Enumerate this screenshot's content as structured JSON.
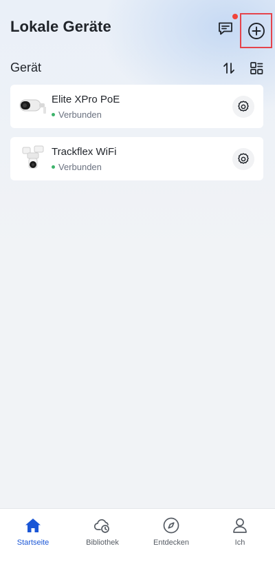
{
  "header": {
    "title": "Lokale Geräte",
    "message_icon": "message-icon",
    "add_icon": "plus-circle-icon",
    "notification_color": "#f0443a",
    "highlight_color": "#e5434b"
  },
  "section": {
    "title": "Gerät",
    "sort_icon": "sort-icon",
    "layout_icon": "grid-layout-icon"
  },
  "devices": [
    {
      "name": "Elite XPro PoE",
      "status": "Verbunden",
      "status_color": "#3db36b"
    },
    {
      "name": "Trackflex WiFi",
      "status": "Verbunden",
      "status_color": "#3db36b"
    }
  ],
  "tabbar": {
    "active_color": "#1a56d6",
    "items": [
      {
        "label": "Startseite",
        "icon": "home-icon",
        "active": true
      },
      {
        "label": "Bibliothek",
        "icon": "cloud-clock-icon",
        "active": false
      },
      {
        "label": "Entdecken",
        "icon": "compass-icon",
        "active": false
      },
      {
        "label": "Ich",
        "icon": "person-icon",
        "active": false
      }
    ]
  }
}
